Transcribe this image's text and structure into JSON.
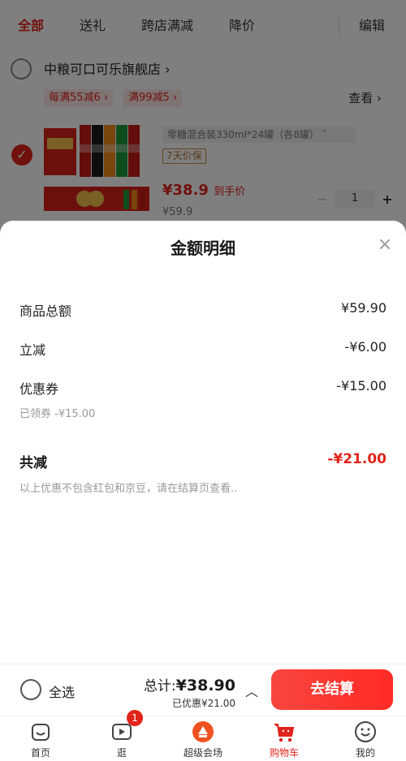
{
  "tabs": [
    "全部",
    "送礼",
    "跨店满减",
    "降价"
  ],
  "edit_label": "编辑",
  "store": {
    "name": "中粮可口可乐旗舰店 ›",
    "promos": [
      "每满55减6 ›",
      "满99减5 ›"
    ],
    "view_label": "查看 ›",
    "product": {
      "spec": "零糖混合装330ml*24罐（各8罐）  ˇ",
      "badge": "7天价保",
      "price": "¥38.9",
      "price_suffix": "到手价",
      "original_price": "¥59.9",
      "quantity": "1"
    }
  },
  "sheet": {
    "title": "金额明细",
    "rows": [
      {
        "label": "商品总额",
        "value": "¥59.90"
      },
      {
        "label": "立减",
        "value": "-¥6.00"
      },
      {
        "label": "优惠券",
        "value": "-¥15.00"
      }
    ],
    "coupon_note": "已领券 -¥15.00",
    "total_label": "共减",
    "total_value": "-¥21.00",
    "disclaimer": "以上优惠不包含红包和京豆，请在结算页查看.."
  },
  "bottom_bar": {
    "select_all": "全选",
    "total_prefix": "总计:",
    "total_amount": "¥38.90",
    "saved": "已优惠¥21.00",
    "checkout": "去结算"
  },
  "tabbar": {
    "items": [
      "首页",
      "逛",
      "超级会场",
      "购物车",
      "我的"
    ],
    "badge_count": "1",
    "active": "购物车"
  },
  "colors": {
    "accent": "#e2231a",
    "overlay": "rgba(0,0,0,0.5)"
  }
}
